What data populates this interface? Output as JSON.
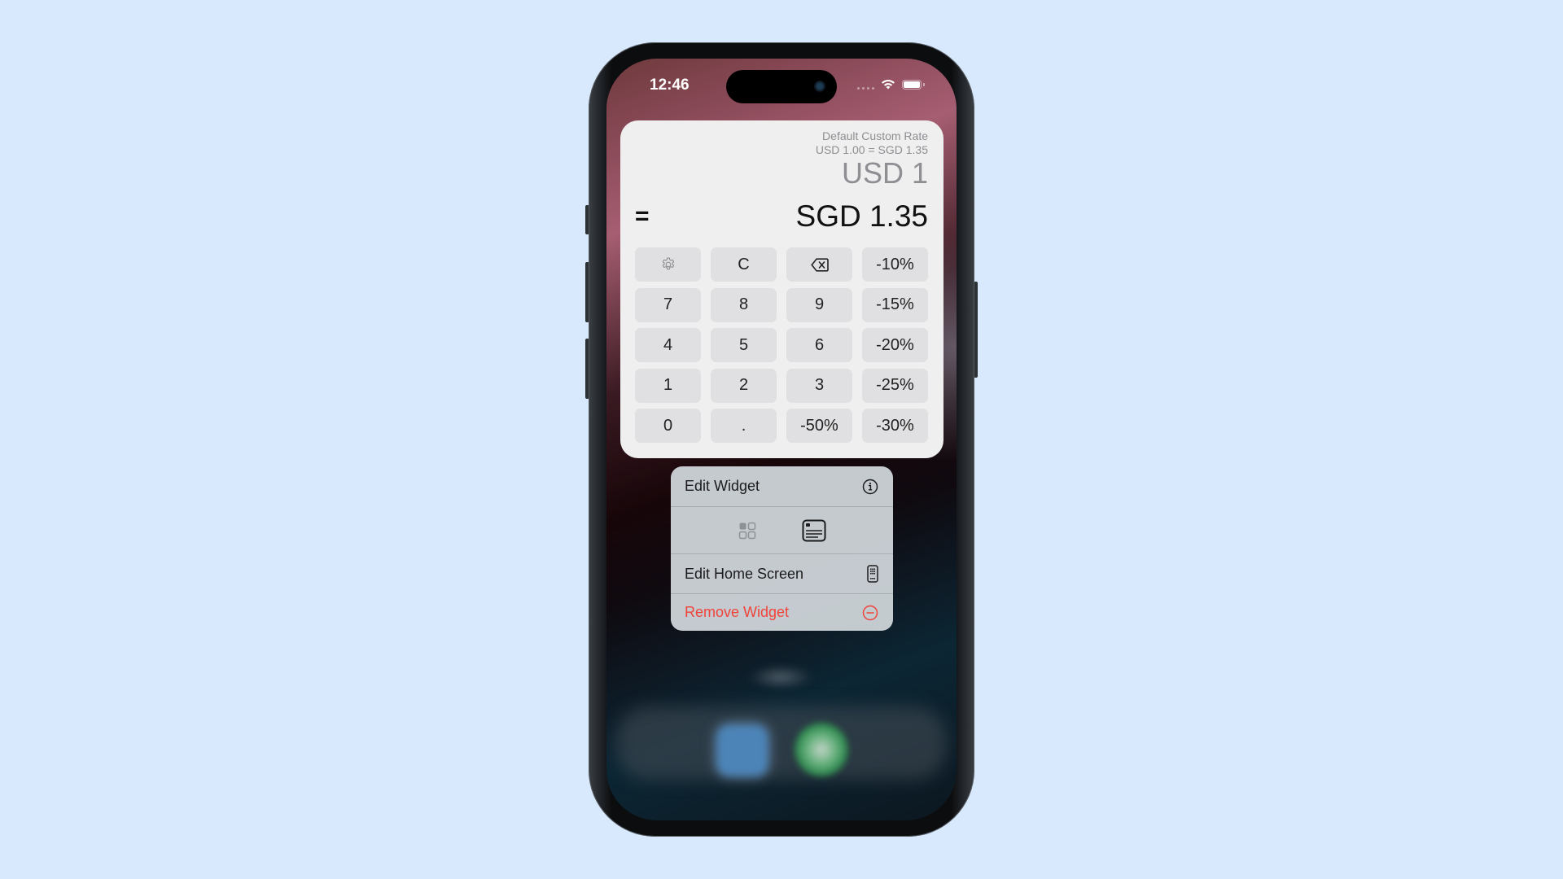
{
  "status_bar": {
    "time": "12:46",
    "icons": [
      "signal-dots-icon",
      "wifi-icon",
      "battery-icon"
    ]
  },
  "widget": {
    "rate_title": "Default Custom Rate",
    "rate_detail": "USD 1.00 = SGD 1.35",
    "input_amount": "USD 1",
    "equals": "=",
    "result_amount": "SGD 1.35",
    "keys": [
      {
        "label": "",
        "icon": "gear-icon",
        "name": "settings-key"
      },
      {
        "label": "C",
        "name": "clear-key"
      },
      {
        "label": "",
        "icon": "backspace-icon",
        "name": "backspace-key"
      },
      {
        "label": "-10%",
        "name": "discount-10-key"
      },
      {
        "label": "7",
        "name": "digit-7-key"
      },
      {
        "label": "8",
        "name": "digit-8-key"
      },
      {
        "label": "9",
        "name": "digit-9-key"
      },
      {
        "label": "-15%",
        "name": "discount-15-key"
      },
      {
        "label": "4",
        "name": "digit-4-key"
      },
      {
        "label": "5",
        "name": "digit-5-key"
      },
      {
        "label": "6",
        "name": "digit-6-key"
      },
      {
        "label": "-20%",
        "name": "discount-20-key"
      },
      {
        "label": "1",
        "name": "digit-1-key"
      },
      {
        "label": "2",
        "name": "digit-2-key"
      },
      {
        "label": "3",
        "name": "digit-3-key"
      },
      {
        "label": "-25%",
        "name": "discount-25-key"
      },
      {
        "label": "0",
        "name": "digit-0-key"
      },
      {
        "label": ".",
        "name": "decimal-key"
      },
      {
        "label": "-50%",
        "name": "discount-50-key"
      },
      {
        "label": "-30%",
        "name": "discount-30-key"
      }
    ]
  },
  "context_menu": {
    "edit_widget": "Edit Widget",
    "edit_widget_icon": "info-icon",
    "size_options": [
      "small-grid-size-icon",
      "medium-widget-size-icon"
    ],
    "selected_size": "medium-widget-size-icon",
    "edit_home_screen": "Edit Home Screen",
    "edit_home_screen_icon": "phone-apps-icon",
    "remove_widget": "Remove Widget",
    "remove_widget_icon": "minus-circle-icon",
    "destructive_color": "#f0443a"
  },
  "dock": {
    "apps": [
      "blurred-blue-app-icon",
      "blurred-green-app-icon"
    ]
  },
  "colors": {
    "background": "#d8e9fe",
    "widget_bg": "#efefef",
    "key_bg": "#e0e0e2",
    "muted_text": "#8e8e93"
  }
}
